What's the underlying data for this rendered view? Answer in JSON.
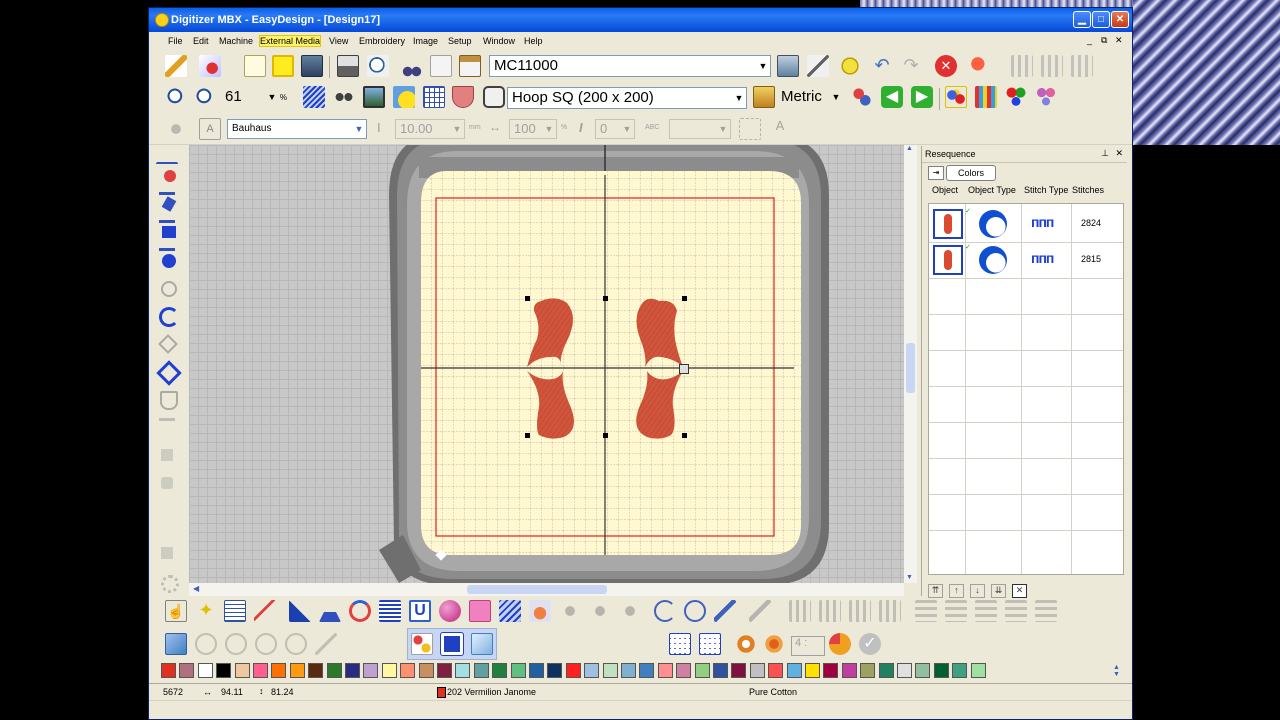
{
  "window": {
    "title": "Digitizer MBX - EasyDesign - [Design17]"
  },
  "menu": [
    "File",
    "Edit",
    "Machine",
    "External Media",
    "View",
    "Embroidery",
    "Image",
    "Setup",
    "Window",
    "Help"
  ],
  "menu_active": "External Media",
  "toolbar1": {
    "machine": "MC11000"
  },
  "toolbar2": {
    "zoom": "61",
    "zoom_unit": "%",
    "hoop": "Hoop SQ (200 x 200)",
    "units": "Metric"
  },
  "toolbar3": {
    "font": "Bauhaus",
    "height": "10.00",
    "height_unit": "mm",
    "width": "100",
    "width_unit": "%",
    "slant": "0",
    "abc_value": ""
  },
  "resequence": {
    "title": "Resequence",
    "button": "Colors",
    "columns": [
      "Object",
      "Object Type",
      "Stitch Type",
      "Stitches"
    ],
    "rows": [
      {
        "stitches": "2824"
      },
      {
        "stitches": "2815"
      }
    ]
  },
  "palette": [
    "#e03020",
    "#b07080",
    "#ffffff",
    "#000000",
    "#f0c8a0",
    "#ff6090",
    "#ff7000",
    "#ff9a10",
    "#5a2a10",
    "#2a7a2a",
    "#2a2a80",
    "#c0a0d0",
    "#fff8a0",
    "#ff9070",
    "#c89060",
    "#802040",
    "#a0e0e0",
    "#60a0a0",
    "#208040",
    "#60c080",
    "#2060a0",
    "#103060",
    "#ff2020",
    "#a0c0e0",
    "#c0e0c0",
    "#80b0d0",
    "#4080c0",
    "#ff9090",
    "#d080a0",
    "#90d080",
    "#3050a0",
    "#801040",
    "#c0c0c0",
    "#ff5050",
    "#60b0e0",
    "#ffe000",
    "#a00040",
    "#c040a0",
    "#a0a060",
    "#208060",
    "#e0e0e0",
    "#90c0a0",
    "#006030",
    "#40a080",
    "#a0e0a0"
  ],
  "status": {
    "stitches": "5672",
    "width": "94.11",
    "height": "81.24",
    "thread": "202 Vermilion Janome",
    "fabric": "Pure Cotton"
  },
  "colors": {
    "accent": "#d84a32",
    "hoop_bg": "#fff8d0",
    "hoop_frame": "#8c8c8c",
    "titlebar": "#0a5ee8"
  },
  "icons": [
    "pencil-icon",
    "wizard-icon",
    "new-icon",
    "open-icon",
    "save-icon",
    "print-icon",
    "preview-icon",
    "cut-icon",
    "copy-icon",
    "paste-icon",
    "zoom-in-icon",
    "zoom-out-icon",
    "undo-icon",
    "redo-icon",
    "stop-icon",
    "hand-icon"
  ]
}
